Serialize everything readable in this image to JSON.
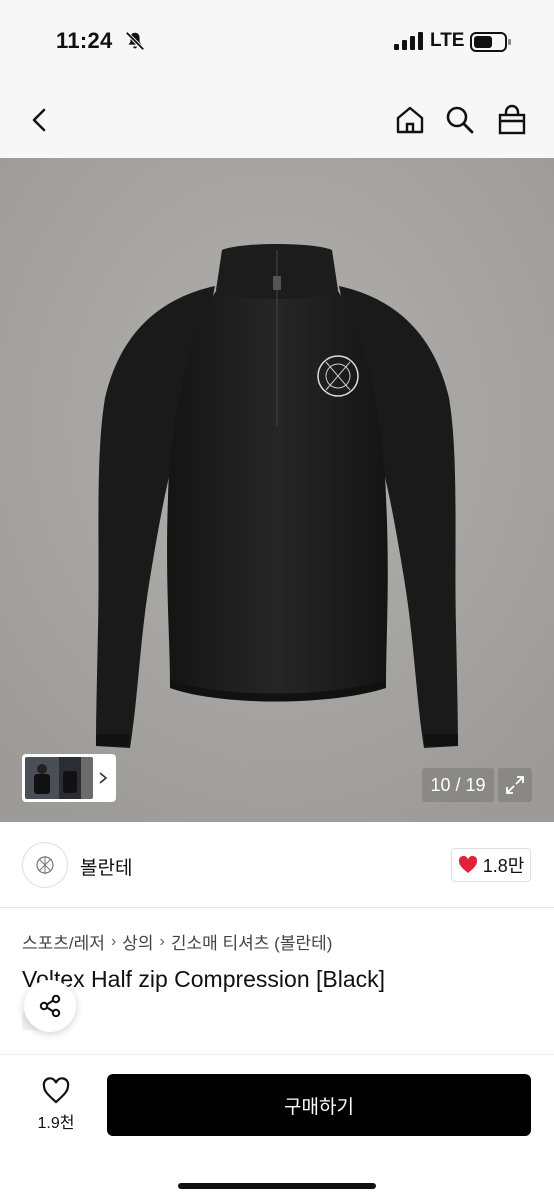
{
  "status": {
    "time": "11:24",
    "network": "LTE"
  },
  "nav": {
    "back_icon": "chevron-left-icon",
    "home_icon": "home-icon",
    "search_icon": "search-icon",
    "cart_icon": "bag-icon"
  },
  "gallery": {
    "counter": "10 / 19",
    "expand_icon": "expand-icon"
  },
  "brand": {
    "name": "볼란테",
    "likes": "1.8만"
  },
  "breadcrumb": [
    "스포츠/레저",
    "상의",
    "긴소매 티셔츠 (볼란테)"
  ],
  "product": {
    "title": "Voltex Half zip Compression [Black]"
  },
  "bottom": {
    "wish_count": "1.9천",
    "buy_label": "구매하기"
  },
  "colors": {
    "accent": "#e0223a",
    "buy_button": "#000000",
    "hero_background": "#a8a6a3"
  }
}
